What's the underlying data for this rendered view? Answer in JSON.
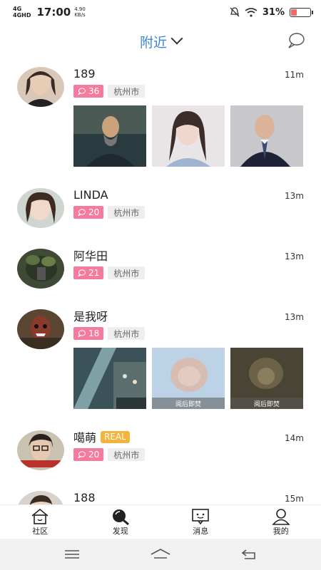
{
  "status_bar": {
    "net1": "4G",
    "net2": "4GHD",
    "time": "17:00",
    "speed_value": "4.90",
    "speed_unit": "KB/s",
    "battery": "31%",
    "battery_level": 0.31
  },
  "header": {
    "title": "附近"
  },
  "posts": [
    {
      "name": "189",
      "time": "11m",
      "count": "36",
      "city": "杭州市"
    },
    {
      "name": "LINDA",
      "time": "13m",
      "count": "20",
      "city": "杭州市"
    },
    {
      "name": "阿华田",
      "time": "13m",
      "count": "21",
      "city": "杭州市"
    },
    {
      "name": "是我呀",
      "time": "13m",
      "count": "18",
      "city": "杭州市",
      "burn_label": "阅后即焚"
    },
    {
      "name": "噶萌",
      "badge": "REAL",
      "time": "14m",
      "count": "20",
      "city": "杭州市"
    },
    {
      "name": "188",
      "time": "15m"
    }
  ],
  "tabs": [
    {
      "label": "社区",
      "icon": "home-icon"
    },
    {
      "label": "发现",
      "icon": "discover-icon"
    },
    {
      "label": "消息",
      "icon": "message-icon"
    },
    {
      "label": "我的",
      "icon": "profile-icon"
    }
  ],
  "colors": {
    "accent": "#3a86d9",
    "count_tag": "#f47a9e",
    "real_badge": "#f3b33d"
  }
}
